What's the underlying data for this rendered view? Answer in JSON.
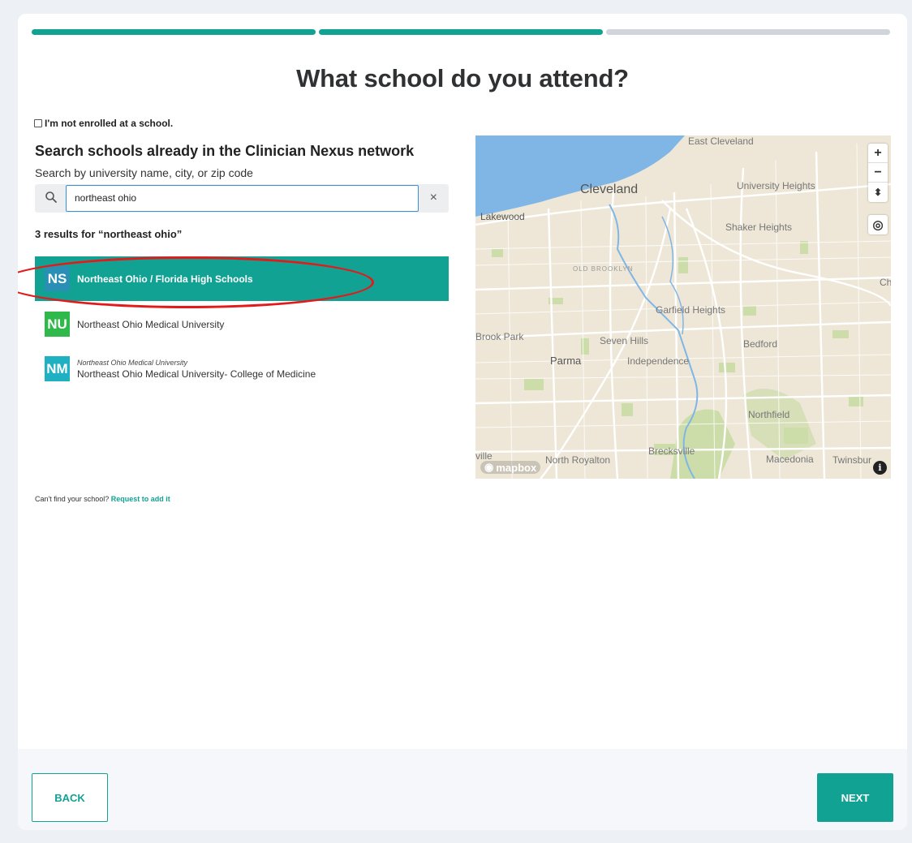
{
  "page": {
    "title": "What school do you attend?"
  },
  "progress": {
    "steps_total": 3,
    "steps_completed": 2,
    "colors": {
      "done": "#11a293",
      "todo": "#d1d5db"
    }
  },
  "enrollment": {
    "not_enrolled_label": "I'm not enrolled at a school.",
    "not_enrolled_checked": false
  },
  "search": {
    "heading": "Search schools already in the Clinician Nexus network",
    "subheading": "Search by university name, city, or zip code",
    "query": "northeast ohio",
    "clear_symbol": "×",
    "icon": "search-icon"
  },
  "results": {
    "summary": "3 results for “northeast ohio”",
    "items": [
      {
        "initials": "NS",
        "name": "Northeast Ohio / Florida High Schools",
        "parent": "",
        "badge_color": "#2a8fb4",
        "selected": true
      },
      {
        "initials": "NU",
        "name": "Northeast Ohio Medical University",
        "parent": "",
        "badge_color": "#2fb94a",
        "selected": false
      },
      {
        "initials": "NM",
        "name": "Northeast Ohio Medical University- College of Medicine",
        "parent": "Northeast Ohio Medical University",
        "badge_color": "#1fb1c2",
        "selected": false
      }
    ]
  },
  "request": {
    "prompt": "Can't find your school?",
    "link": "Request to add it"
  },
  "map": {
    "labels": {
      "east_cleveland": "East Cleveland",
      "cleveland": "Cleveland",
      "university_heights": "University Heights",
      "lakewood": "Lakewood",
      "shaker_heights": "Shaker Heights",
      "old_brooklyn": "OLD BROOKLYN",
      "garfield_heights": "Garfield Heights",
      "brook_park": "Brook Park",
      "seven_hills": "Seven Hills",
      "bedford": "Bedford",
      "parma": "Parma",
      "independence": "Independence",
      "northfield": "Northfield",
      "north_royalton": "North Royalton",
      "brecksville": "Brecksville",
      "macedonia": "Macedonia",
      "twinsburg": "Twinsbur",
      "edge_right": "Ch",
      "edge_left": "ville"
    },
    "controls": {
      "zoom_in": "+",
      "zoom_out": "−",
      "compass": "⬍",
      "locate": "◎"
    },
    "attribution": "mapbox",
    "info": "i",
    "colors": {
      "water": "#7fb6e6",
      "land": "#eee7d7",
      "park": "#c9dca5",
      "road": "#ffffff"
    }
  },
  "footer": {
    "back_label": "BACK",
    "next_label": "NEXT"
  }
}
